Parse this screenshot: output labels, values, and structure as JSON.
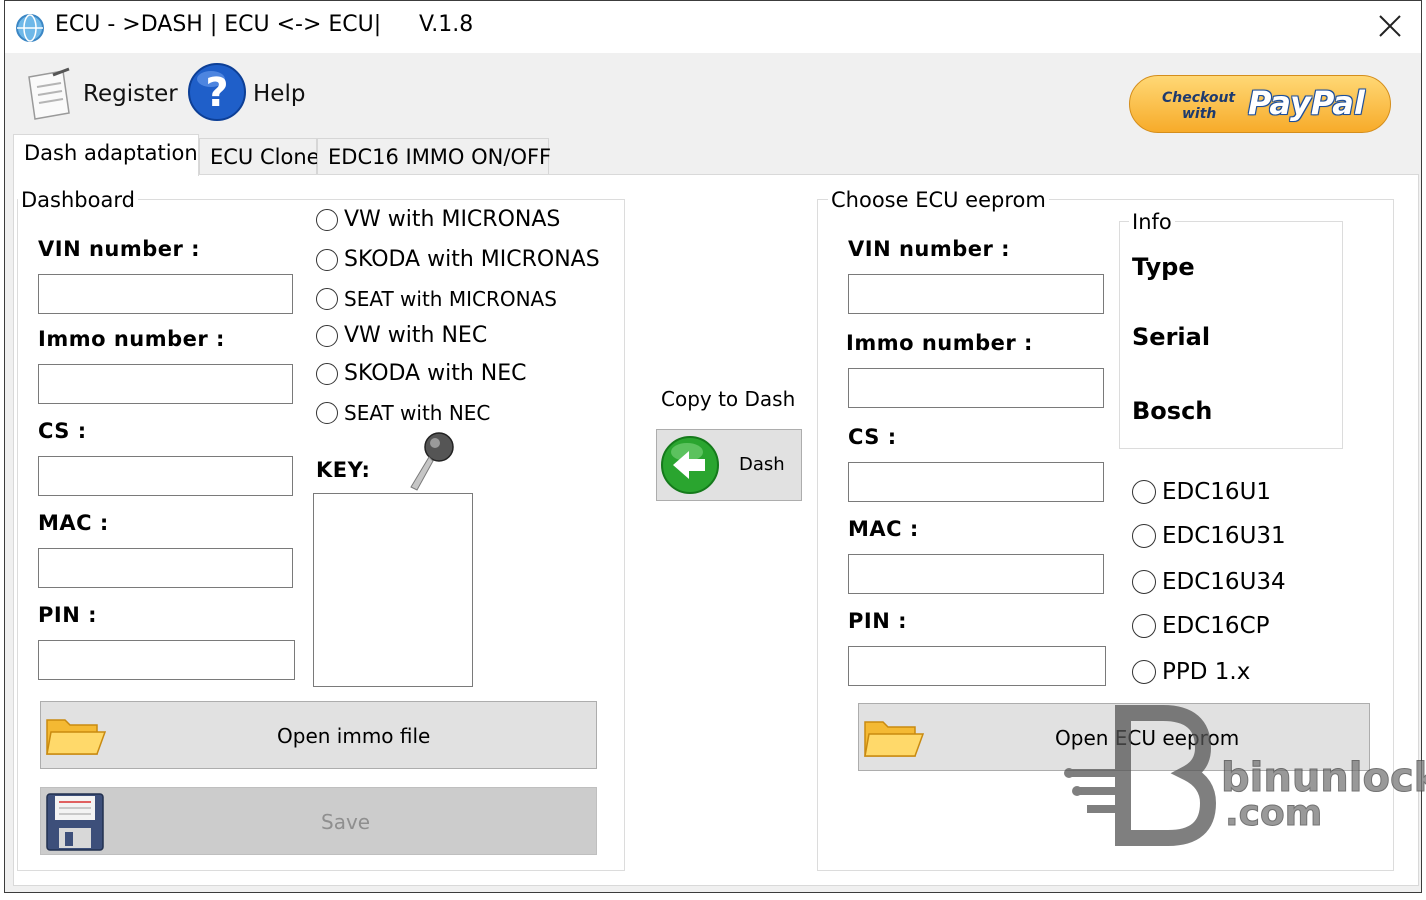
{
  "window": {
    "title": "ECU - >DASH | ECU <-> ECU|",
    "version": "V.1.8"
  },
  "toolbar": {
    "register_label": "Register",
    "help_label": "Help",
    "paypal_checkout": "Checkout",
    "paypal_with": "with",
    "paypal_brand": "PayPal"
  },
  "tabs": [
    {
      "label": "Dash adaptation",
      "active": true
    },
    {
      "label": "ECU Clone",
      "active": false
    },
    {
      "label": "EDC16 IMMO ON/OFF",
      "active": false
    }
  ],
  "dashboard": {
    "title": "Dashboard",
    "vin_label": "VIN number :",
    "immo_label": "Immo number :",
    "cs_label": "CS :",
    "mac_label": "MAC :",
    "pin_label": "PIN :",
    "radios": [
      "VW with MICRONAS",
      "SKODA with MICRONAS",
      "SEAT with MICRONAS",
      "VW with NEC",
      "SKODA with NEC",
      "SEAT with NEC"
    ],
    "key_label": "KEY:",
    "open_button": "Open immo file",
    "save_button": "Save"
  },
  "copy": {
    "label": "Copy to Dash",
    "button": "Dash"
  },
  "ecu": {
    "title": "Choose ECU eeprom",
    "vin_label": "VIN number :",
    "immo_label": "Immo number :",
    "cs_label": "CS :",
    "mac_label": "MAC :",
    "pin_label": "PIN :",
    "info_title": "Info",
    "info_type": "Type",
    "info_serial": "Serial",
    "info_bosch": "Bosch",
    "radios": [
      "EDC16U1",
      "EDC16U31",
      "EDC16U34",
      "EDC16CP",
      "PPD 1.x"
    ],
    "open_button": "Open ECU eeprom"
  },
  "watermark": {
    "line1": "binunlock",
    "line2": ".com"
  }
}
